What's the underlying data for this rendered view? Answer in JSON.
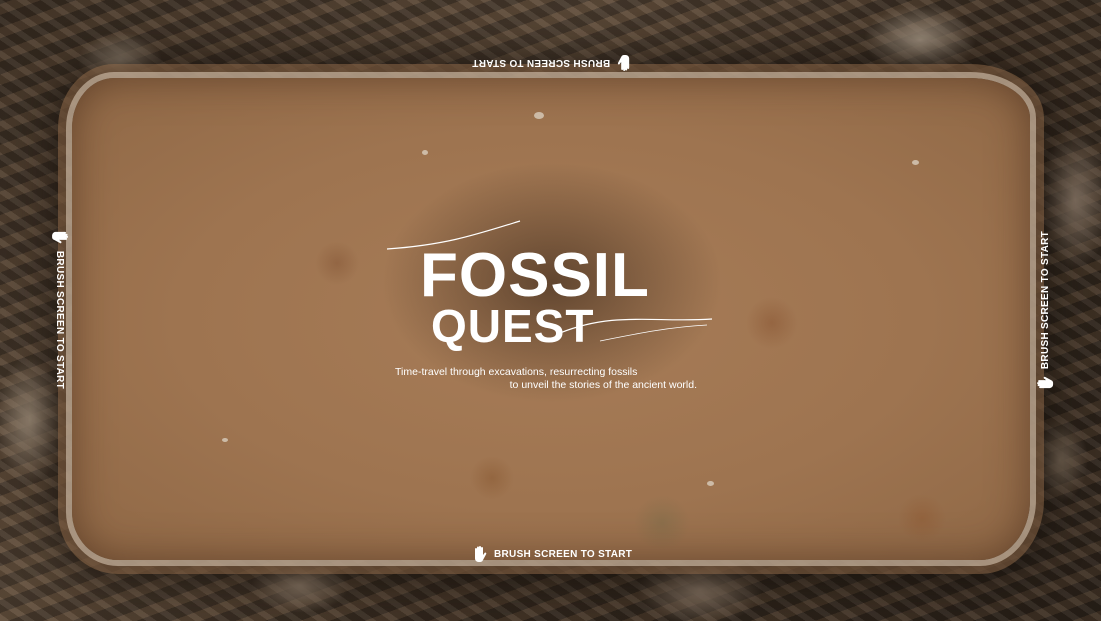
{
  "game": {
    "logo": {
      "word_top": "FOSSIL",
      "word_bottom": "QUEST"
    },
    "tagline": {
      "line1": "Time-travel through excavations, resurrecting fossils",
      "line2": "to unveil the stories of the ancient world."
    },
    "prompts": {
      "top": "BRUSH SCREEN TO START",
      "bottom": "BRUSH SCREEN TO START",
      "left": "BRUSH SCREEN TO START",
      "right": "BRUSH SCREEN TO START",
      "icon": "hand-icon"
    },
    "colors": {
      "text": "#ffffff",
      "sand": "#a77c57",
      "rock": "#3b2f25"
    }
  }
}
